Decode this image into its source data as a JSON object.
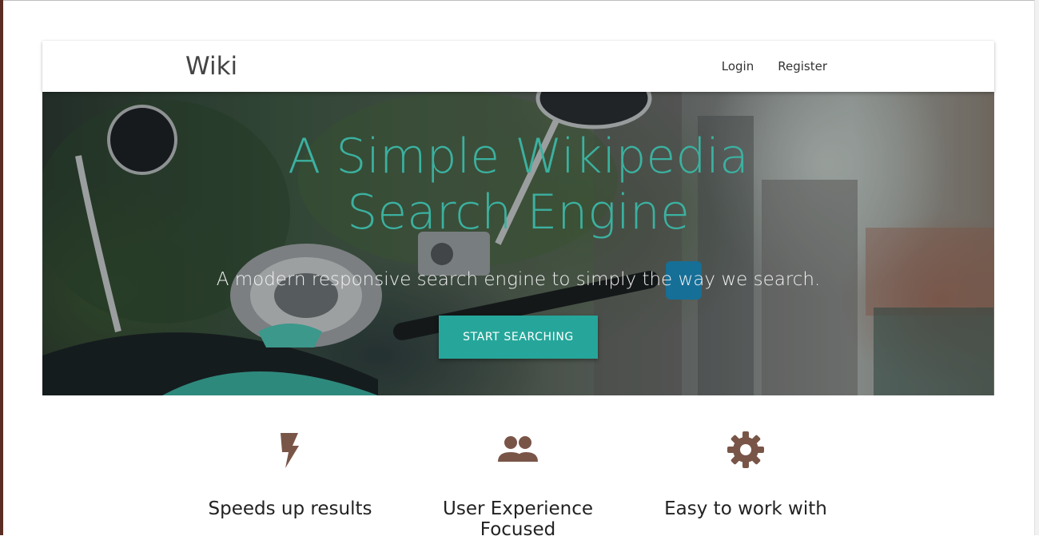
{
  "navbar": {
    "brand": "Wiki",
    "links": [
      "Login",
      "Register"
    ]
  },
  "hero": {
    "title": "A Simple Wikipedia Search Engine",
    "subtitle": "A modern responsive search engine to simply the way we search.",
    "cta_label": "START SEARCHING"
  },
  "features": [
    {
      "icon": "bolt-icon",
      "title": "Speeds up results"
    },
    {
      "icon": "users-icon",
      "title": "User Experience Focused"
    },
    {
      "icon": "gear-icon",
      "title": "Easy to work with"
    }
  ],
  "colors": {
    "accent": "#26a69a",
    "title": "#3bb1a0",
    "icon": "#795548"
  }
}
